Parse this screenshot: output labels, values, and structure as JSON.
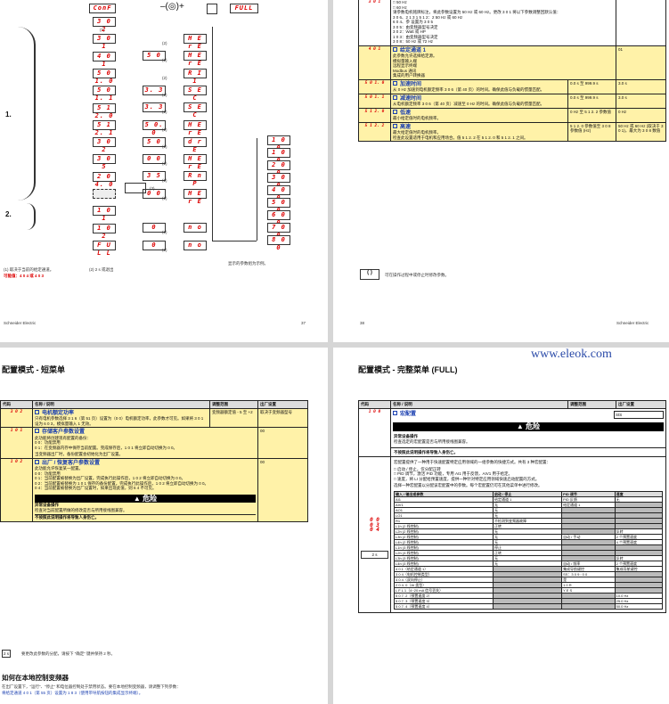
{
  "top_left": {
    "menu_start": "ConF",
    "menu_end_label": "FULL",
    "marker1": "1.",
    "marker2": "2.",
    "marker_n1": "(1)",
    "marker_n2": "(2)",
    "marker_n3": "(3)",
    "left_column": [
      "3 0 2",
      "3 0 1",
      "4 0 1",
      "5 0 1. 0",
      "5 0 1. 1",
      "5 1 2. 0",
      "5 1 2. 1",
      "3 0 2",
      "3 0 5",
      "2 0 4. 0",
      "",
      "1 0 1",
      "1 0 2",
      "F U L L"
    ],
    "right_values": [
      "H E r E",
      "H E r E",
      "R I 1",
      "S E C",
      "S E C",
      "H E r E",
      "d r E",
      "H E r E",
      "R n P",
      "H E r E",
      "",
      "n o",
      "n o"
    ],
    "mid_values": [
      "",
      "5 0",
      "",
      "3. 3",
      "3. 3",
      "5 0. 0",
      "5 0",
      "0 0",
      "3 5",
      "0 0",
      "",
      "0",
      "0"
    ],
    "far_column": [
      "1 0 0",
      "1 0 0",
      "2 0 0",
      "3 0 0",
      "4 0 0",
      "5 0 0",
      "6 0 0",
      "7 0 0",
      "8 0 0"
    ],
    "note1": "(1) 取决于当前的给定通道。",
    "note1b": "可能值：4 0 4 或 4 0 3",
    "note2": "(2) 2 s 或退出",
    "note3": "显示的参数组为示例。",
    "footer_left": "Schneider Electric",
    "footer_right": "37"
  },
  "top_right": {
    "rows": [
      {
        "code": "3 0 1",
        "lines": [
          "□ 50 Hz",
          "□ 60 Hz",
          "请参数电机铭牌标注，将此参数设置为 50 Hz 或 60 Hz。更改 3 0 1 将以下参数调整回默认值：",
          "3 0 6、2 1 3 1 5 1 2：2 50 Hz 或 60 Hz",
          "6 0 4、参 设置为 3 0 5",
          "3 0 5：由变频器型号决定",
          "3 0 2：Watt 或 HP",
          "1 0 3：由变频器型号决定",
          "3 0 8：50 Hz 或 72 Hz"
        ]
      },
      {
        "code": "4 0 1",
        "title": "给定通道 1",
        "lines": [
          "此参数允许选择给定源。",
          "模拟量输入端",
          "远程显示终端",
          "Modbus 通讯",
          "集成的用户转换器"
        ],
        "value": "01"
      },
      {
        "code": "5 0 1. 0",
        "title": "加速时间",
        "lines": [
          "从 0 Hz 加速到电机额定频率 3 0 6（第 40 页）的时间。确保此值与负载的惯量匹配。"
        ],
        "range": "0.0 s 至 999.9 s",
        "value": "3.0 s"
      },
      {
        "code": "5 0 1. 1",
        "title": "减速时间",
        "lines": [
          "从电机额定频率 3 0 6（第 40 页）减速至 0 Hz 的时间。确保此值与负载的惯量匹配。"
        ],
        "range": "0.0 s 至 999.9 s",
        "value": "3.0 s"
      },
      {
        "code": "5 1 2. 0",
        "title": "低速",
        "lines": [
          "最小给定值时的电机频率。"
        ],
        "range": "0 Hz 至 5 1 2. 2 参数值",
        "value": "0 Hz"
      },
      {
        "code": "5 1 2. 2",
        "title": "高速",
        "lines": [
          "最大给定值时的电机频率。",
          "检查此设置适用于电机和应用场合。值 5 1 2. 2 在 5 1 2. 0 和 5 1 2. 1 之间。"
        ],
        "range": "5 1 2. 0 参数值至 3 0 8 参数值 (Hz)",
        "value": "50 Hz 或 60 Hz (取决于 3 0 1)，最大为 3 0 8 数值"
      }
    ],
    "legend_icon": "( )",
    "legend_text": "可在操作过程中或停止时修改参数。",
    "footer_left": "38",
    "footer_right": "Schneider Electric"
  },
  "bottom_left": {
    "heading": "配置模式 - 短菜单",
    "col_code": "代码",
    "col_name": "名称 / 说明",
    "col_range": "调整范围",
    "col_default": "出厂设置",
    "rows": [
      {
        "code": "3 0 2",
        "title": "电机额定功率",
        "desc": "只有电机参数选择 3 1 6（第 51 页）设置为（0 0）电机额定功率，此参数才可见。如果将 3 0 1 设为 6 0 3，模拟量输入 1 无效。",
        "range": "变频器额定值 - 5 至 +2",
        "value": "取决于变频器型号"
      },
      {
        "code": "1 0 1",
        "title": "存储客户参数设置",
        "desc": "此功能将创建现有配置的备份：",
        "items": [
          "0 0：功能禁用",
          "0 1：在变频器内存中保存当前配置。完成保存后，1 0 1 将立即自动切换为 0 0。"
        ],
        "note": "当变频器出厂时，备份配置会初始化为出厂设置。",
        "value": "00"
      },
      {
        "code": "1 0 2",
        "title": "出厂 / 恢复客户参数设置",
        "desc": "此功能允许恢复某一配置。",
        "items": [
          "0 0：功能禁用",
          "0 1：当前配置被替换为出厂设置。完成执行此操作后，1 0 2 将立即自动切换为 0 0。",
          "0 2：当前配置被替换为 1 0 1 保存的备份配置。完成执行此操作后，1 0 2 将立即自动切换为 0 0。",
          "0 4：当前配置被替换为出厂设置时，如果出现此值，则 6 4 不可见。"
        ],
        "value": "00"
      }
    ],
    "danger_label": "危险",
    "danger_title": "异常设备操作",
    "danger_text": "检查对当前配置所做的修改是否与所用接线图兼容。",
    "danger_warn": "不按照此说明操作将导致人身伤亡。",
    "timer_icon": "2 s",
    "timer_text": "要更改此参数的分配，请按下 “确定” 键并保持 2 秒。",
    "section_title": "如何在本地控制变频器",
    "section_text": "在出厂设置下，“运行”、“停止” 和电位器控制处于禁用状态。要在本地控制变频器，请调整下列参数：",
    "section_text2": "将给定通道 4 0 1（第 55 页）设置为 1 8 3（使用带导航按钮的集成显示终端）。"
  },
  "bottom_right": {
    "heading": "配置模式 - 完整菜单 (FULL)",
    "watermark": "www.eleok.com",
    "col_code": "代码",
    "col_name": "名称 / 说明",
    "col_range": "调整范围",
    "col_default": "出厂设置",
    "macro_code": "1 0 0",
    "macro_title": "宏配置",
    "macro_value": "StS",
    "danger_label": "危险",
    "danger_title": "异常设备操作",
    "danger_text": "检查选定的宏配置是否与所用接线图兼容。",
    "danger_warn": "不按照此说明操作将导致人身伤亡。",
    "desc1": "宏配置提供了一种用于快速配置特定应用领域的一组参数的快捷方式。共有 3 种宏配置：",
    "items": [
      "启动 / 停止，仅分配正转",
      "PID 调节，激活 PID 功能，专用 AI1 用于反馈，AIV1 用于给定。",
      "速度，将 LI 分配给预置速度，提供一种针对特定应用领域快速启动配置的方式。"
    ],
    "desc2": "选择一种宏配置以分配该宏配置中的参数。每个宏配置仍可在其他菜单中进行修改。",
    "codes": [
      "0 0",
      "0 3",
      "0 4"
    ],
    "timer_icon": "2 s",
    "matrix_head": [
      "输入 / 输出或参数",
      "启动 / 停止",
      "PID 调节",
      "速度"
    ],
    "matrix_rows": [
      [
        "AI1",
        "给定通道 1",
        "PID 反馈",
        "无"
      ],
      [
        "AIV1",
        "无",
        "给定通道 1",
        ""
      ],
      [
        "AO1",
        "无",
        "",
        ""
      ],
      [
        "LO1",
        "无",
        "",
        ""
      ],
      [
        "R1",
        "不检测到变频器故障",
        "",
        ""
      ],
      [
        "L1h (2 线控制)",
        "正转",
        "",
        ""
      ],
      [
        "L2h (2 线控制)",
        "无",
        "",
        "反转"
      ],
      [
        "L3h (2 线控制)",
        "无",
        "自动 / 手动",
        "2 个预置速度"
      ],
      [
        "L4h (2 线控制)",
        "无",
        "",
        "4 个预置速度"
      ],
      [
        "L1h (3 线控制)",
        "停止",
        "",
        ""
      ],
      [
        "L2h (3 线控制)",
        "正转",
        "",
        ""
      ],
      [
        "L3h (3 线控制)",
        "无",
        "",
        "反转"
      ],
      [
        "L4h (3 线控制)",
        "无",
        "自动 / 频率",
        "2 个预置速度"
      ],
      [
        "4 0 1（给定通道 1）",
        "",
        "集成导航键控",
        "集成导航键控"
      ],
      [
        "3 0 4（电机控制类型）",
        "",
        "SS：3 0 9 : 0 0",
        ""
      ],
      [
        "4 0 4（双向停止）",
        "",
        "是",
        ""
      ],
      [
        "2 0 4. 0（AI 类型）",
        "",
        "1 0 R",
        ""
      ],
      [
        "L F L 1（4~20 mA 信号丢失）",
        "",
        "Y E S",
        ""
      ],
      [
        "5 0 7. 2（预置速度 2）",
        "",
        "",
        "10.0 Hz"
      ],
      [
        "5 0 7. 3（预置速度 3）",
        "",
        "",
        "25.0 Hz"
      ],
      [
        "5 0 7. 4（预置速度 4）",
        "",
        "",
        "50.0 Hz"
      ]
    ]
  }
}
